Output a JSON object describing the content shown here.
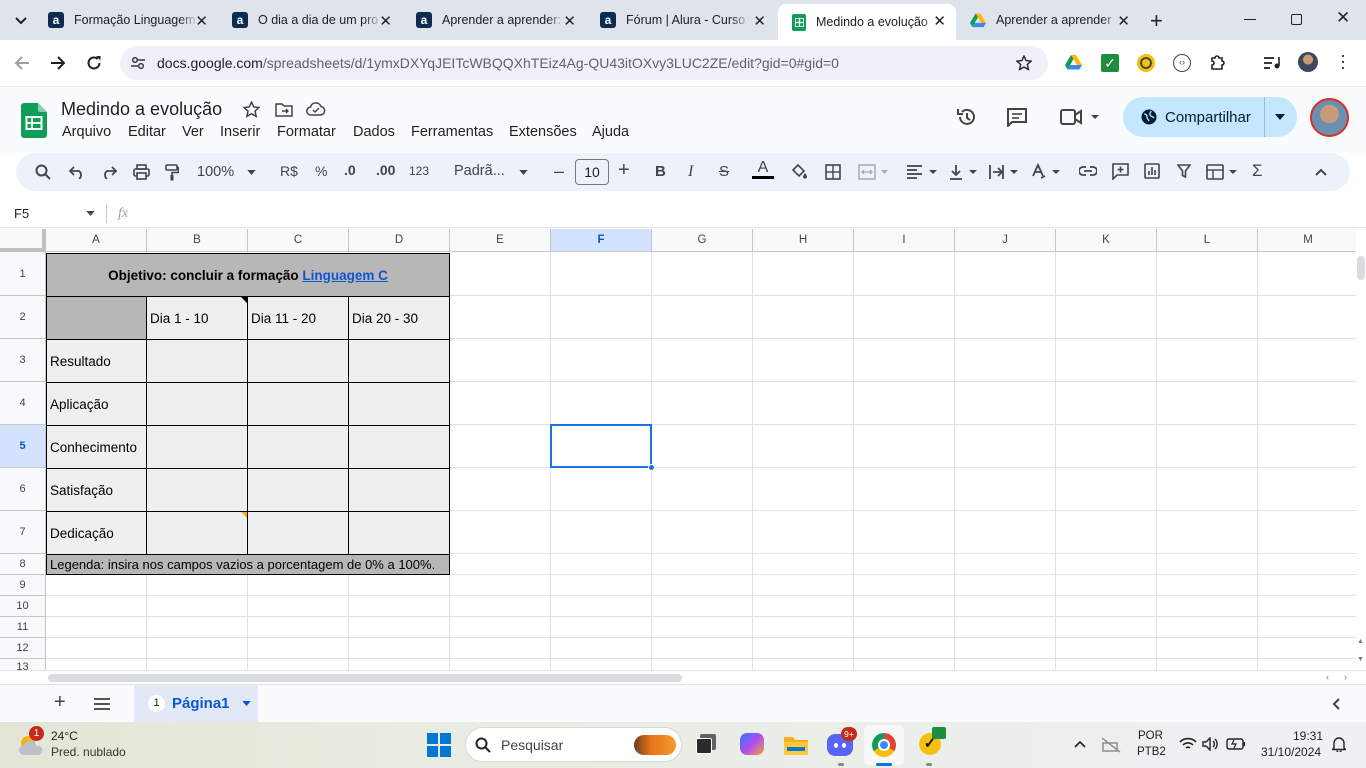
{
  "browser": {
    "tabs": [
      {
        "title": "Formação Linguagem",
        "icon": "alura-icon"
      },
      {
        "title": "O dia a dia de um pro",
        "icon": "alura-icon"
      },
      {
        "title": "Aprender a aprender:",
        "icon": "alura-icon"
      },
      {
        "title": "Fórum | Alura - Curso",
        "icon": "alura-icon"
      },
      {
        "title": "Medindo a evolução",
        "icon": "sheets-icon"
      },
      {
        "title": "Aprender a aprender",
        "icon": "drive-icon"
      }
    ],
    "active_tab": 4,
    "url_host": "docs.google.com",
    "url_path": "/spreadsheets/d/1ymxDXYqJEITcWBQQXhTEiz4Ag-QU43itOXvy3LUC2ZE/edit?gid=0#gid=0"
  },
  "sheets": {
    "doc_title": "Medindo a evolução",
    "menus": [
      "Arquivo",
      "Editar",
      "Ver",
      "Inserir",
      "Formatar",
      "Dados",
      "Ferramentas",
      "Extensões",
      "Ajuda"
    ],
    "share_label": "Compartilhar",
    "toolbar": {
      "zoom": "100%",
      "currency": "R$",
      "percent": "%",
      "dec_less": ".0",
      "dec_more": ".00",
      "number_format": "123",
      "font": "Padrã...",
      "font_size": "10",
      "font_minus": "–",
      "font_plus": "+",
      "bold": "B",
      "italic": "I",
      "strike": "S",
      "text_color": "A",
      "sum": "Σ"
    },
    "name_box": "F5",
    "fx": "fx",
    "columns": [
      "A",
      "B",
      "C",
      "D",
      "E",
      "F",
      "G",
      "H",
      "I",
      "J",
      "K",
      "L",
      "M"
    ],
    "selected_column": "F",
    "rows": [
      "1",
      "2",
      "3",
      "4",
      "5",
      "6",
      "7",
      "8",
      "9",
      "10",
      "11",
      "12",
      "13"
    ],
    "selected_row": "5",
    "selected_cell": "F5",
    "cells": {
      "title_prefix": "Objetivo: concluir a formação ",
      "title_link": "Linguagem C",
      "header_b": "Dia 1 - 10",
      "header_c": "Dia 11 - 20",
      "header_d": "Dia 20 - 30",
      "labels": [
        "Resultado",
        "Aplicação",
        "Conhecimento",
        "Satisfação",
        "Dedicação"
      ],
      "legend": "Legenda: insira nos campos vazios a porcentagem de 0% a 100%."
    },
    "colors": {
      "header_fill": "#b7b7b7",
      "body_fill": "#efefef",
      "selection": "#1a73e8",
      "link": "#1155cc"
    },
    "sheet_tab": {
      "number": "1",
      "name": "Página1"
    }
  },
  "taskbar": {
    "weather_temp": "24°C",
    "weather_desc": "Pred. nublado",
    "weather_badge": "1",
    "search_placeholder": "Pesquisar",
    "discord_badge": "9+",
    "lang_1": "POR",
    "lang_2": "PTB2",
    "time": "19:31",
    "date": "31/10/2024"
  }
}
